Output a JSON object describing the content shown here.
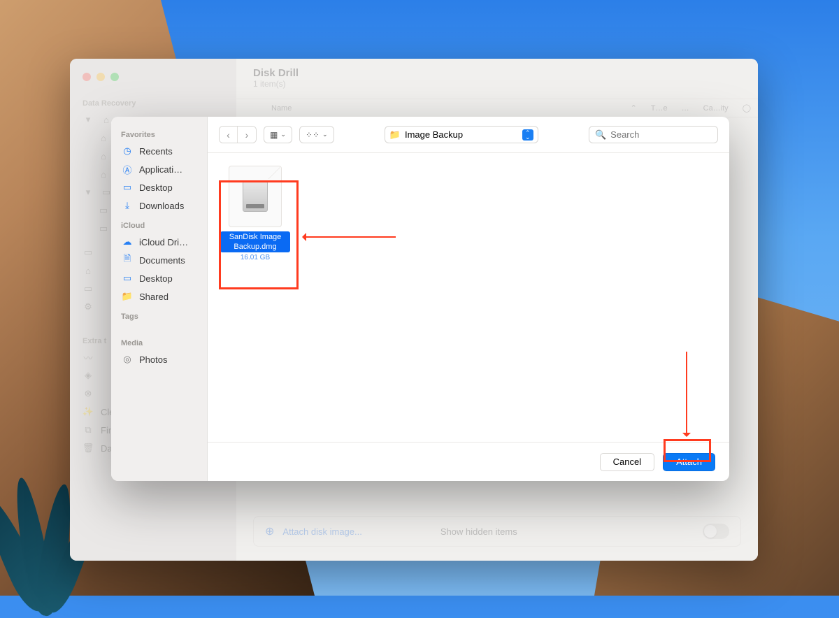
{
  "bg": {
    "title": "Disk Drill",
    "subtitle": "1 item(s)",
    "cols": {
      "name": "Name",
      "type": "T…e",
      "dots": "…",
      "capacity": "Ca…ity"
    },
    "sidebar": {
      "section1": "Data Recovery",
      "section2": "Extra t",
      "items2": {
        "cleanup": "Clean Up",
        "dup": "Find Duplicates",
        "shred": "Data Shredder"
      }
    },
    "bottom": {
      "attach": "Attach disk image...",
      "hidden": "Show hidden items"
    }
  },
  "dlg": {
    "sidebar": {
      "favorites": "Favorites",
      "icloud": "iCloud",
      "tags": "Tags",
      "media": "Media",
      "items": {
        "recents": "Recents",
        "applications": "Applicati…",
        "desktop": "Desktop",
        "downloads": "Downloads",
        "iclouddrive": "iCloud Dri…",
        "documents": "Documents",
        "desktop2": "Desktop",
        "shared": "Shared",
        "photos": "Photos"
      }
    },
    "location": "Image Backup",
    "search_placeholder": "Search",
    "file": {
      "name": "SanDisk Image Backup.dmg",
      "size": "16.01 GB"
    },
    "buttons": {
      "cancel": "Cancel",
      "attach": "Attach"
    }
  }
}
